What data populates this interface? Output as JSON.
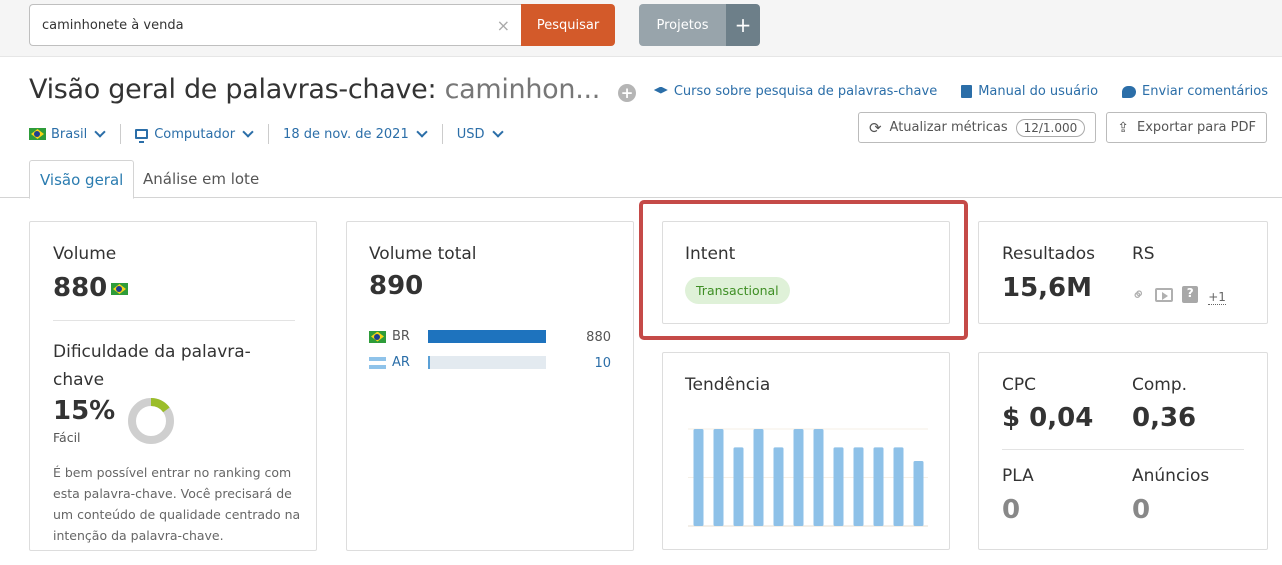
{
  "search": {
    "value": "caminhonete à venda",
    "clear_label": "×",
    "button_label": "Pesquisar"
  },
  "projects": {
    "label": "Projetos",
    "add_label": "+"
  },
  "header": {
    "title_prefix": "Visão geral de palavras-chave:",
    "title_keyword": "caminhon...",
    "add_icon": "+",
    "filters": {
      "country": "Brasil",
      "device": "Computador",
      "date": "18 de nov. de 2021",
      "currency": "USD"
    },
    "links": [
      {
        "icon": "graduation-cap-icon",
        "label": "Curso sobre pesquisa de palavras-chave"
      },
      {
        "icon": "book-icon",
        "label": "Manual do usuário"
      },
      {
        "icon": "comment-icon",
        "label": "Enviar comentários"
      }
    ],
    "update_metrics": {
      "label": "Atualizar métricas",
      "badge": "12/1.000"
    },
    "export_pdf": {
      "label": "Exportar para PDF"
    }
  },
  "tabs": [
    {
      "label": "Visão geral",
      "active": true
    },
    {
      "label": "Análise em lote",
      "active": false
    }
  ],
  "volume_card": {
    "label": "Volume",
    "value": "880",
    "kd_label": "Dificuldade da palavra-chave",
    "kd_value": "15%",
    "kd_percent": 15,
    "kd_level": "Fácil",
    "kd_description": "É bem possível entrar no ranking com esta palavra-chave. Você precisará de um conteúdo de qualidade centrado na intenção da palavra-chave.",
    "kd_color": "#9bbd2a"
  },
  "total_volume_card": {
    "label": "Volume total",
    "value": "890",
    "countries": [
      {
        "code": "BR",
        "value": "880",
        "share": 1.0
      },
      {
        "code": "AR",
        "value": "10",
        "share": 0.0114
      }
    ]
  },
  "intent_card": {
    "label": "Intent",
    "intent": "Transactional"
  },
  "trend_card": {
    "label": "Tendência"
  },
  "results_card": {
    "results_label": "Resultados",
    "results_value": "15,6M",
    "serp_label": "RS",
    "serp_features": [
      "link-icon",
      "video-icon",
      "question-icon"
    ],
    "serp_more": "+1"
  },
  "cpc_card": {
    "cpc_label": "CPC",
    "cpc_value": "$ 0,04",
    "comp_label": "Comp.",
    "comp_value": "0,36",
    "pla_label": "PLA",
    "pla_value": "0",
    "ads_label": "Anúncios",
    "ads_value": "0"
  },
  "chart_data": {
    "type": "bar",
    "title": "Tendência",
    "categories": [
      "1",
      "2",
      "3",
      "4",
      "5",
      "6",
      "7",
      "8",
      "9",
      "10",
      "11",
      "12"
    ],
    "values": [
      1.0,
      1.0,
      0.81,
      1.0,
      0.81,
      1.0,
      1.0,
      0.81,
      0.81,
      0.81,
      0.81,
      0.67
    ],
    "xlabel": "",
    "ylabel": "",
    "ylim": [
      0,
      1.0
    ],
    "grid": true,
    "color": "#8ec1e8"
  }
}
